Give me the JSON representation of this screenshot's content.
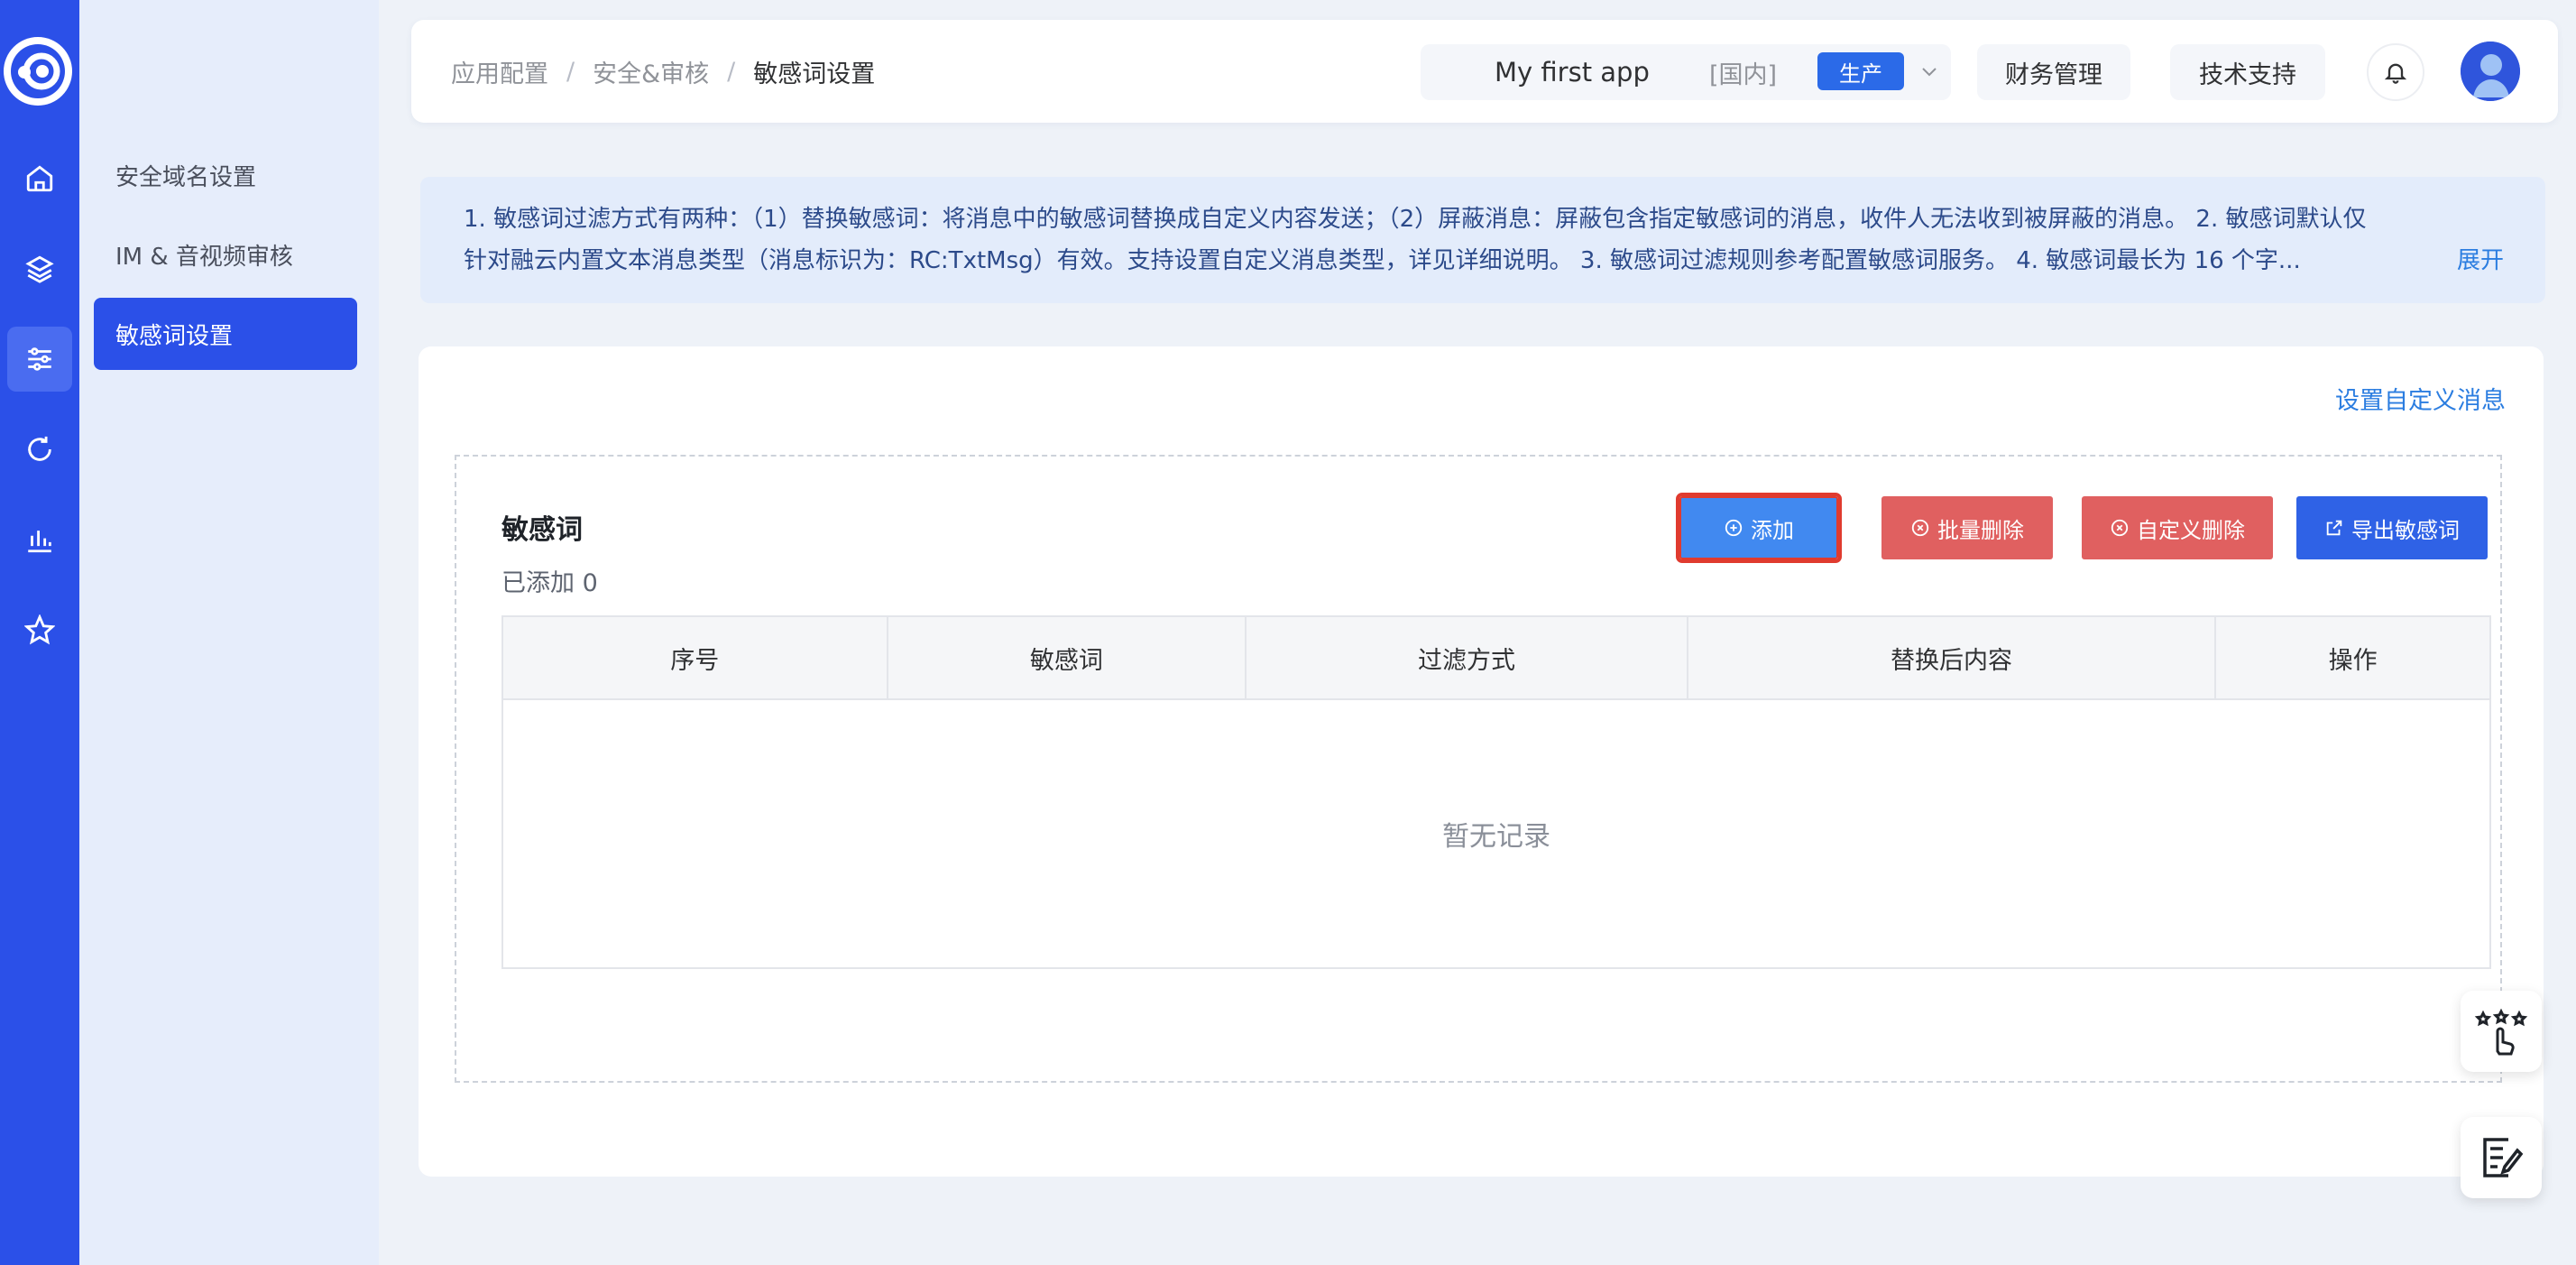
{
  "rail": {
    "items": [
      {
        "icon": "home-icon"
      },
      {
        "icon": "layers-icon"
      },
      {
        "icon": "sliders-icon",
        "active": true
      },
      {
        "icon": "refresh-icon"
      },
      {
        "icon": "bar-chart-icon"
      },
      {
        "icon": "star-icon"
      }
    ]
  },
  "subnav": {
    "items": [
      {
        "label": "安全域名设置"
      },
      {
        "label": "IM & 音视频审核"
      },
      {
        "label": "敏感词设置",
        "active": true
      }
    ]
  },
  "header": {
    "breadcrumb": [
      "应用配置",
      "安全&审核",
      "敏感词设置"
    ],
    "breadcrumb_sep": "/",
    "app_name": "My first app",
    "region": "[国内]",
    "env_tag": "生产",
    "finance": "财务管理",
    "support": "技术支持"
  },
  "info": {
    "line1": "1. 敏感词过滤方式有两种：（1）替换敏感词：将消息中的敏感词替换成自定义内容发送；（2）屏蔽消息：屏蔽包含指定敏感词的消息，收件人无法收到被屏蔽的消息。 2. 敏感词默认仅",
    "line2": "针对融云内置文本消息类型（消息标识为：RC:TxtMsg）有效。支持设置自定义消息类型，详见详细说明。 3. 敏感词过滤规则参考配置敏感词服务。 4. 敏感词最长为 16 个字...",
    "expand": "展开"
  },
  "card": {
    "custom_link": "设置自定义消息",
    "title": "敏感词",
    "count": "已添加 0",
    "buttons": {
      "add": "添加",
      "bulk_delete": "批量删除",
      "custom_delete": "自定义删除",
      "export": "导出敏感词"
    },
    "table": {
      "columns": [
        "序号",
        "敏感词",
        "过滤方式",
        "替换后内容",
        "操作"
      ],
      "empty_text": "暂无记录"
    }
  },
  "colors": {
    "rail": "#2b50e8",
    "primary": "#2b50e8",
    "danger": "#e06060",
    "link": "#2b7de0"
  }
}
